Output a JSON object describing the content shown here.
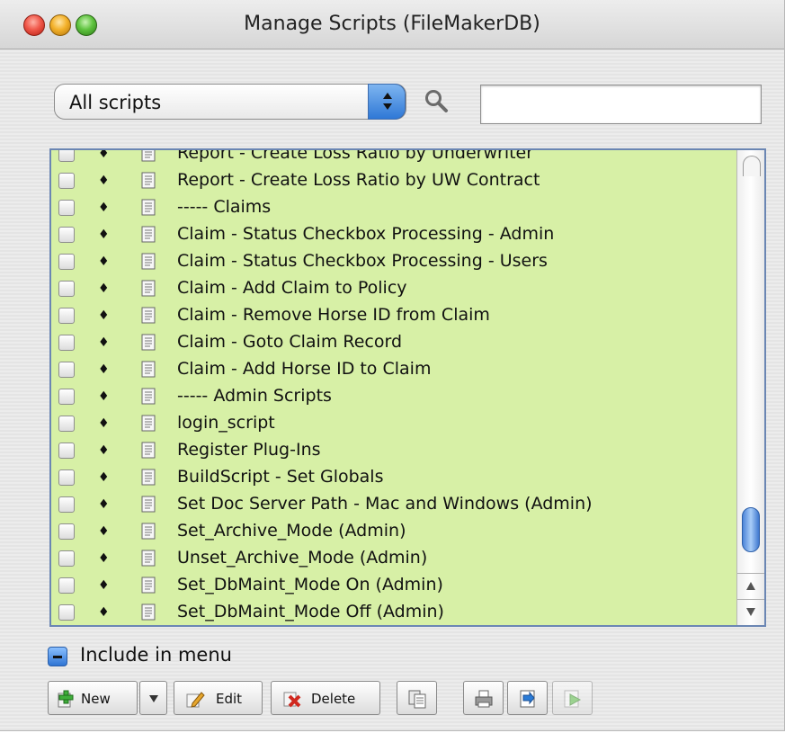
{
  "window": {
    "title": "Manage Scripts (FileMakerDB)"
  },
  "filter": {
    "selected": "All scripts",
    "search_placeholder": "",
    "search_value": ""
  },
  "scripts": [
    {
      "name": "Report - Create Loss Ratio by Underwriter"
    },
    {
      "name": "Report - Create Loss Ratio by UW Contract"
    },
    {
      "name": "----- Claims"
    },
    {
      "name": "Claim - Status Checkbox Processing - Admin"
    },
    {
      "name": "Claim - Status Checkbox Processing - Users"
    },
    {
      "name": "Claim - Add Claim to Policy"
    },
    {
      "name": "Claim - Remove Horse ID from Claim"
    },
    {
      "name": "Claim - Goto Claim Record"
    },
    {
      "name": "Claim - Add Horse ID to Claim"
    },
    {
      "name": "----- Admin Scripts"
    },
    {
      "name": "login_script"
    },
    {
      "name": "Register Plug-Ins"
    },
    {
      "name": "BuildScript - Set Globals"
    },
    {
      "name": "Set Doc Server Path - Mac and Windows (Admin)"
    },
    {
      "name": "Set_Archive_Mode (Admin)"
    },
    {
      "name": "Unset_Archive_Mode (Admin)"
    },
    {
      "name": "Set_DbMaint_Mode On (Admin)"
    },
    {
      "name": "Set_DbMaint_Mode Off (Admin)"
    }
  ],
  "list": {
    "background": "#d7f0a6",
    "scroll_position": 0.85
  },
  "include_in_menu": {
    "label": "Include in menu",
    "state": "mixed"
  },
  "toolbar": {
    "new_label": "New",
    "edit_label": "Edit",
    "delete_label": "Delete"
  }
}
